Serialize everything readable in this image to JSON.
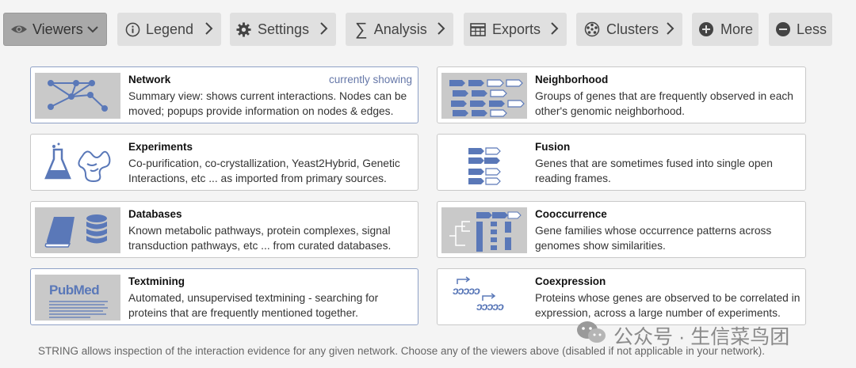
{
  "toolbar": {
    "viewers": "Viewers",
    "legend": "Legend",
    "settings": "Settings",
    "analysis": "Analysis",
    "exports": "Exports",
    "clusters": "Clusters",
    "more": "More",
    "less": "Less"
  },
  "viewers": [
    {
      "title": "Network",
      "note": "currently showing",
      "desc": "Summary view: shows current interactions. Nodes can be moved; popups provide information on nodes & edges."
    },
    {
      "title": "Neighborhood",
      "desc": "Groups of genes that are frequently observed in each other's genomic neighborhood."
    },
    {
      "title": "Experiments",
      "desc": "Co-purification, co-crystallization, Yeast2Hybrid, Genetic Interactions, etc ... as imported from primary sources."
    },
    {
      "title": "Fusion",
      "desc": "Genes that are sometimes fused into single open reading frames."
    },
    {
      "title": "Databases",
      "desc": "Known metabolic pathways, protein complexes, signal transduction pathways, etc ... from curated databases."
    },
    {
      "title": "Cooccurrence",
      "desc": "Gene families whose occurrence patterns across genomes show similarities."
    },
    {
      "title": "Textmining",
      "desc": "Automated, unsupervised textmining - searching for proteins that are frequently mentioned together."
    },
    {
      "title": "Coexpression",
      "desc": "Proteins whose genes are observed to be correlated in expression, across a large number of experiments."
    }
  ],
  "thumb_text": {
    "pubmed": "PubMed",
    "coexp_a": "ɔɔɔɔɔ",
    "coexp_b": "ɔɔɔɔɔ"
  },
  "footer": "STRING allows inspection of the interaction evidence for any given network. Choose any of the viewers above (disabled if not applicable in your network).",
  "watermark": "公众号 · 生信菜鸟团",
  "colors": {
    "accent": "#5a78b8",
    "active_tab": "#a9a9a9",
    "tab": "#e0e0e0"
  }
}
